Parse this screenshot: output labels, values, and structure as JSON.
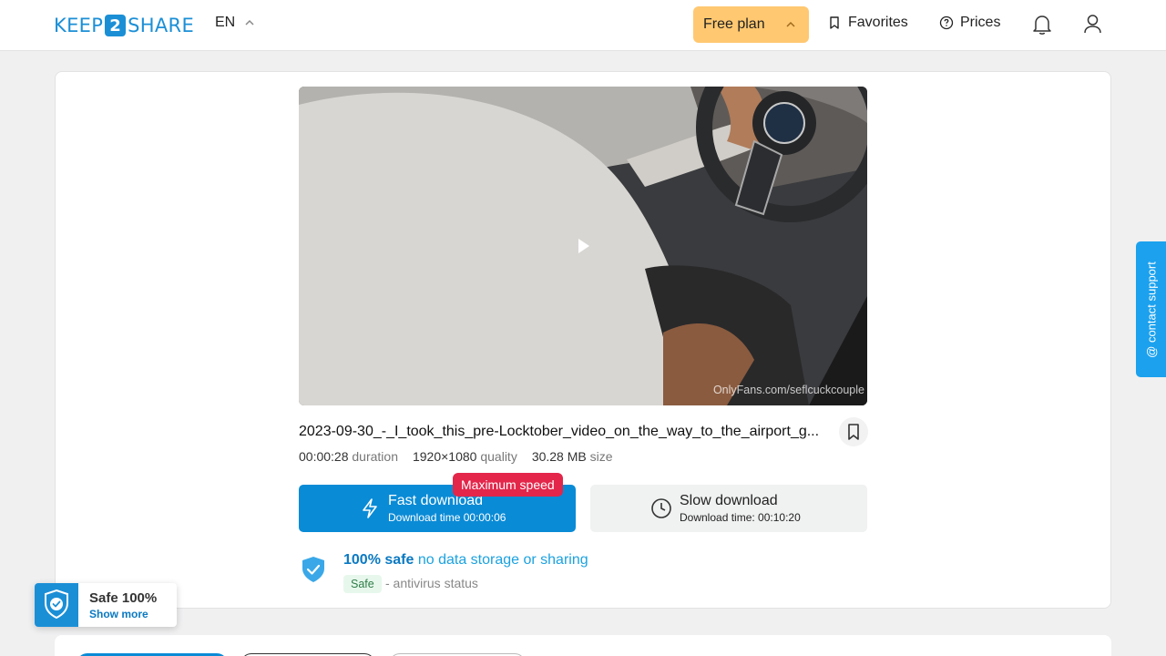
{
  "header": {
    "logo_left": "KEEP",
    "logo_mid": "2",
    "logo_right": "SHARE",
    "language": "EN",
    "free_plan": "Free plan",
    "favorites": "Favorites",
    "prices": "Prices"
  },
  "video": {
    "watermark": "OnlyFans.com/seflcuckcouple",
    "filename": "2023-09-30_-_I_took_this_pre-Locktober_video_on_the_way_to_the_airport_g...",
    "duration_value": "00:00:28",
    "duration_label": "duration",
    "quality_value": "1920×1080",
    "quality_label": "quality",
    "size_value": "30.28 MB",
    "size_label": "size"
  },
  "download": {
    "badge": "Maximum speed",
    "fast_title": "Fast download",
    "fast_time": "Download time 00:00:06",
    "slow_title": "Slow download",
    "slow_time": "Download time: 00:10:20"
  },
  "safety": {
    "title_bold": "100% safe",
    "title_rest": "no data storage or sharing",
    "badge": "Safe",
    "status": "- antivirus status"
  },
  "contact_support": "@ contact support",
  "safe_widget": {
    "title": "Safe 100%",
    "link": "Show more"
  },
  "colors": {
    "brand_blue": "#1b8fd6",
    "fast_button": "#0a8bd6",
    "free_plan": "#ffc871",
    "max_speed_badge": "#e3264a"
  }
}
